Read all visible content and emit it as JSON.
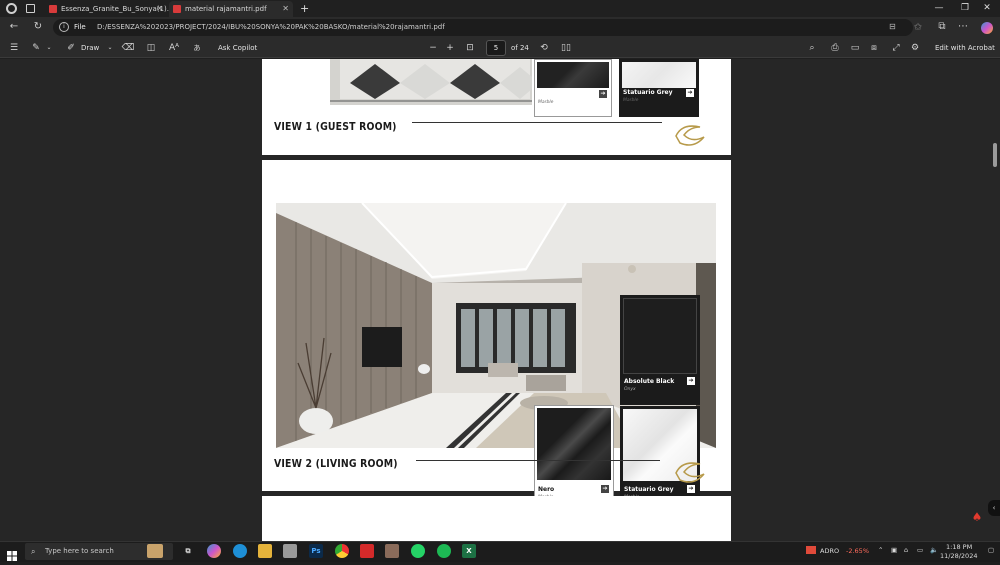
{
  "tabs": [
    {
      "label": "Essenza_Granite_Bu_Sonya(1).pdf",
      "active": false
    },
    {
      "label": "material rajamantri.pdf",
      "active": true
    }
  ],
  "address": {
    "prefix": "File",
    "url": "D:/ESSENZA%202023/PROJECT/2024/IBU%20SONYA%20PAK%20BASKO/material%20rajamantri.pdf"
  },
  "toolbar": {
    "draw_label": "Draw",
    "ask_copilot_label": "Ask Copilot",
    "page_current": "5",
    "page_total": "of 24",
    "edit_acrobat_label": "Edit with Acrobat"
  },
  "pages": {
    "top": {
      "view_title": "VIEW 1 (GUEST ROOM)",
      "swatches": [
        {
          "name": "Nero",
          "type": "Marble"
        },
        {
          "name": "Statuario Grey",
          "type": "Marble"
        }
      ]
    },
    "middle": {
      "view_title": "VIEW 2 (LIVING ROOM)",
      "swatches": [
        {
          "name": "Absolute Black",
          "type": "Onyx"
        },
        {
          "name": "Nero",
          "type": "Marble"
        },
        {
          "name": "Statuario Grey",
          "type": "Marble"
        }
      ]
    }
  },
  "taskbar": {
    "search_placeholder": "Type here to search",
    "stock_name": "ADRO",
    "stock_change": "-2.65%",
    "time": "1:18 PM",
    "date": "11/28/2024"
  },
  "colors": {
    "accent_red": "#d83b3b",
    "stock_negative": "#ff6b5b"
  }
}
